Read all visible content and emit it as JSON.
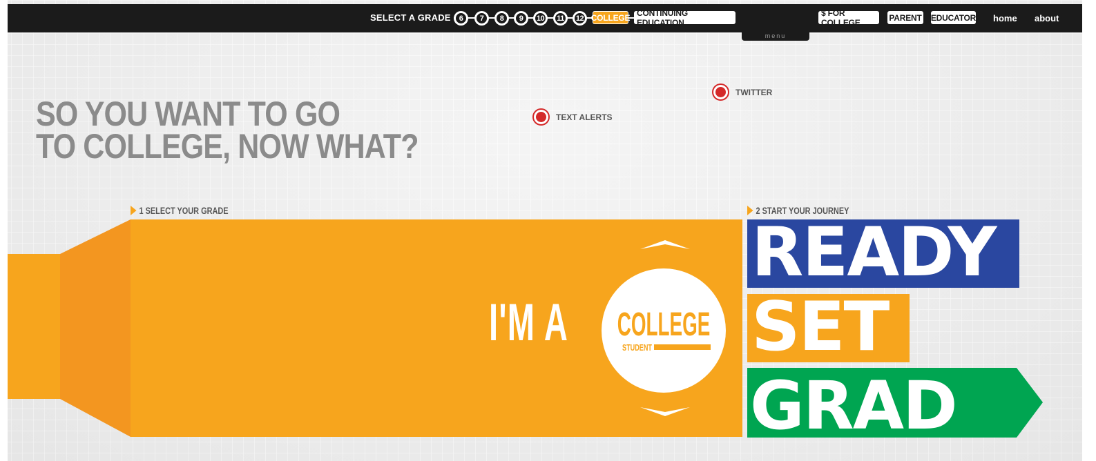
{
  "nav": {
    "select_grade_label": "SELECT A GRADE",
    "grades": [
      "6",
      "7",
      "8",
      "9",
      "10",
      "11",
      "12"
    ],
    "college_label": "COLLEGE",
    "continuing_label": "CONTINUING EDUCATION",
    "money_label": "$ FOR COLLEGE",
    "parent_label": "PARENT",
    "educator_label": "EDUCATOR",
    "home_label": "home",
    "about_label": "about",
    "menu_label": "menu"
  },
  "headline": {
    "line1": "SO YOU WANT TO GO",
    "line2": "TO COLLEGE, NOW WHAT?"
  },
  "social": {
    "twitter": "TWITTER",
    "text_alerts": "TEXT ALERTS"
  },
  "steps": {
    "step1": "1 SELECT YOUR GRADE",
    "step2": "2 START YOUR JOURNEY"
  },
  "selector": {
    "prefix": "I'M A",
    "grade": "COLLEGE",
    "sub": "STUDENT"
  },
  "journey": {
    "ready": "READY",
    "set": "SET",
    "grad": "GRAD"
  },
  "colors": {
    "orange": "#f7a51d",
    "orange_dark": "#f39620",
    "blue": "#2a47a0",
    "green": "#00a551",
    "red_dot": "#d42a2a",
    "nav_bg": "#1b1b1b"
  },
  "icons": {
    "step_marker": "triangle-right-icon",
    "chevron_up": "chevron-up-icon",
    "chevron_down": "chevron-down-icon",
    "social_dot": "red-dot-icon"
  }
}
